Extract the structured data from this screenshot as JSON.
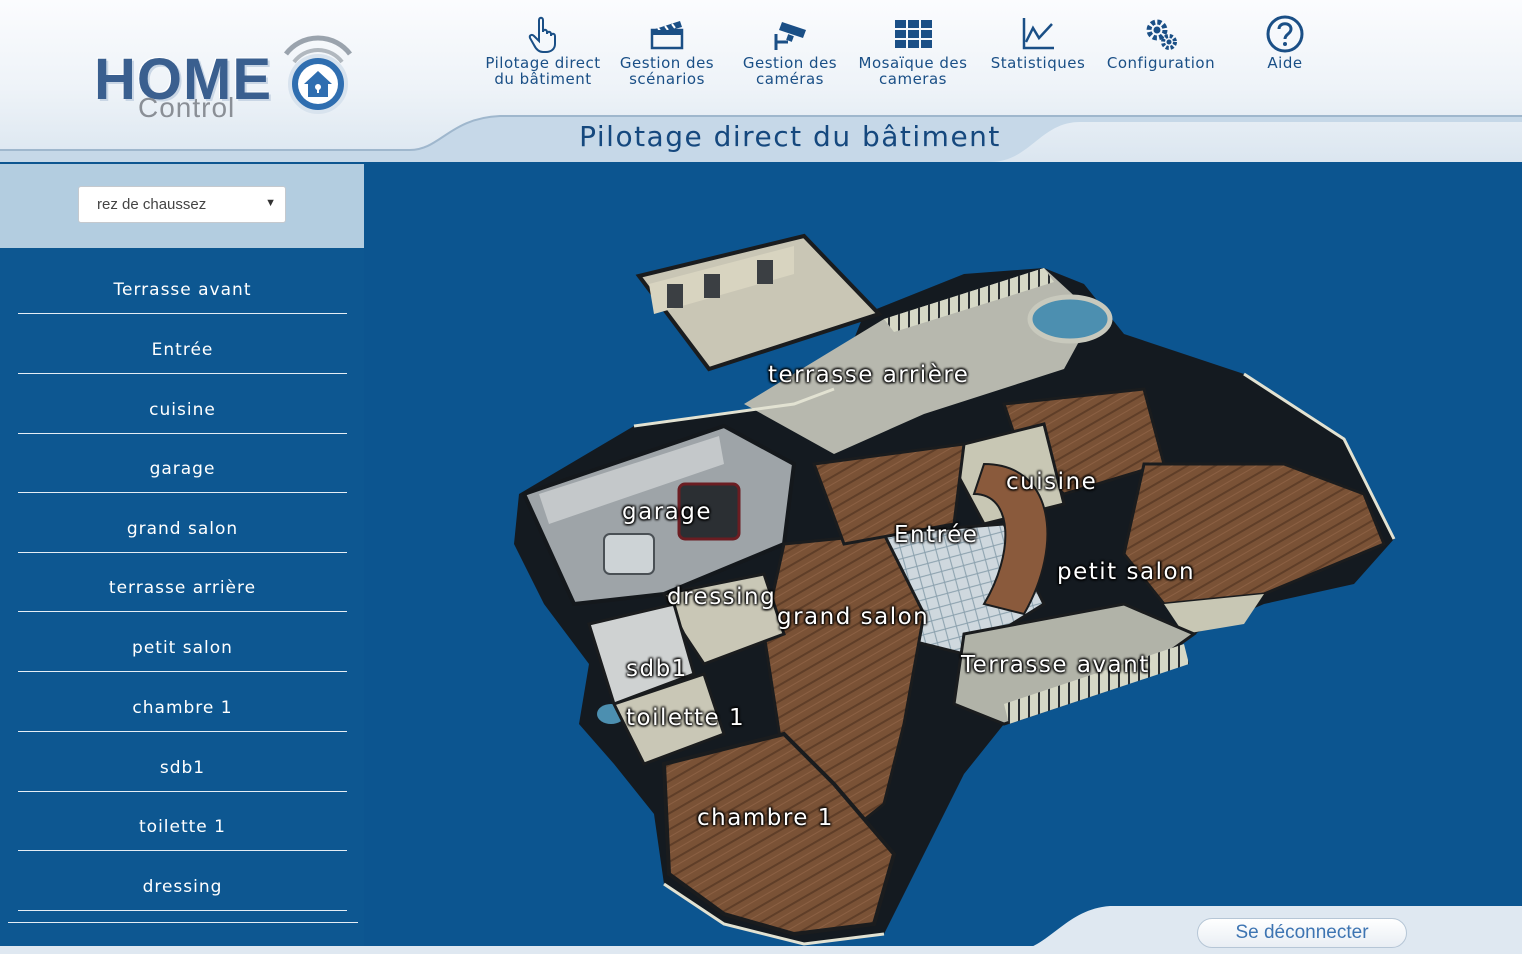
{
  "app": {
    "logo_main": "HOME",
    "logo_sub": "Control",
    "page_title": "Pilotage direct du bâtiment"
  },
  "nav": [
    {
      "label": "Pilotage direct du bâtiment",
      "icon": "hand-pointer-icon"
    },
    {
      "label": "Gestion des scénarios",
      "icon": "clapperboard-icon"
    },
    {
      "label": "Gestion des caméras",
      "icon": "security-camera-icon"
    },
    {
      "label": "Mosaïque des cameras",
      "icon": "grid-icon"
    },
    {
      "label": "Statistiques",
      "icon": "line-chart-icon"
    },
    {
      "label": "Configuration",
      "icon": "gears-icon"
    },
    {
      "label": "Aide",
      "icon": "question-circle-icon"
    }
  ],
  "floor_select": {
    "value": "rez de chaussez"
  },
  "rooms": [
    "Terrasse avant",
    "Entrée",
    "cuisine",
    "garage",
    "grand salon",
    "terrasse arrière",
    "petit salon",
    "chambre 1",
    "sdb1",
    "toilette 1",
    "dressing"
  ],
  "plan_labels": {
    "terrasse_arriere": "terrasse arrière",
    "cuisine": "cuisine",
    "garage": "garage",
    "entree": "Entrée",
    "petit_salon": "petit salon",
    "dressing": "dressing",
    "grand_salon": "grand salon",
    "terrasse_avant": "Terrasse avant",
    "sdb1": "sdb1",
    "toilette1": "toilette 1",
    "chambre1": "chambre 1"
  },
  "footer": {
    "logout_label": "Se déconnecter"
  },
  "colors": {
    "brand_blue": "#1a4f86",
    "panel_blue": "#0d5791",
    "light_panel": "#b3cde0",
    "floor_wood": "#7a5236",
    "wall": "#c7c8b4"
  }
}
